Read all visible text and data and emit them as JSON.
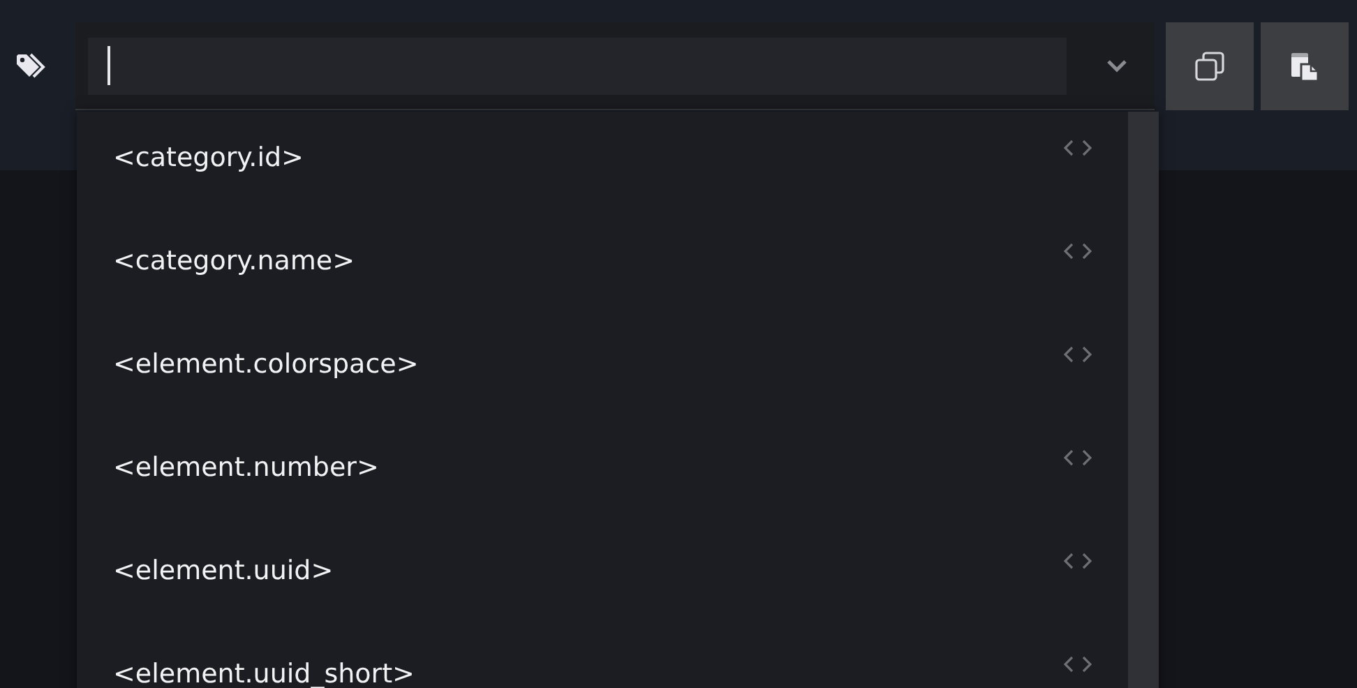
{
  "suggestions": [
    {
      "label": "<category.id>"
    },
    {
      "label": "<category.name>"
    },
    {
      "label": "<element.colorspace>"
    },
    {
      "label": "<element.number>"
    },
    {
      "label": "<element.uuid>"
    },
    {
      "label": "<element.uuid_short>"
    }
  ]
}
